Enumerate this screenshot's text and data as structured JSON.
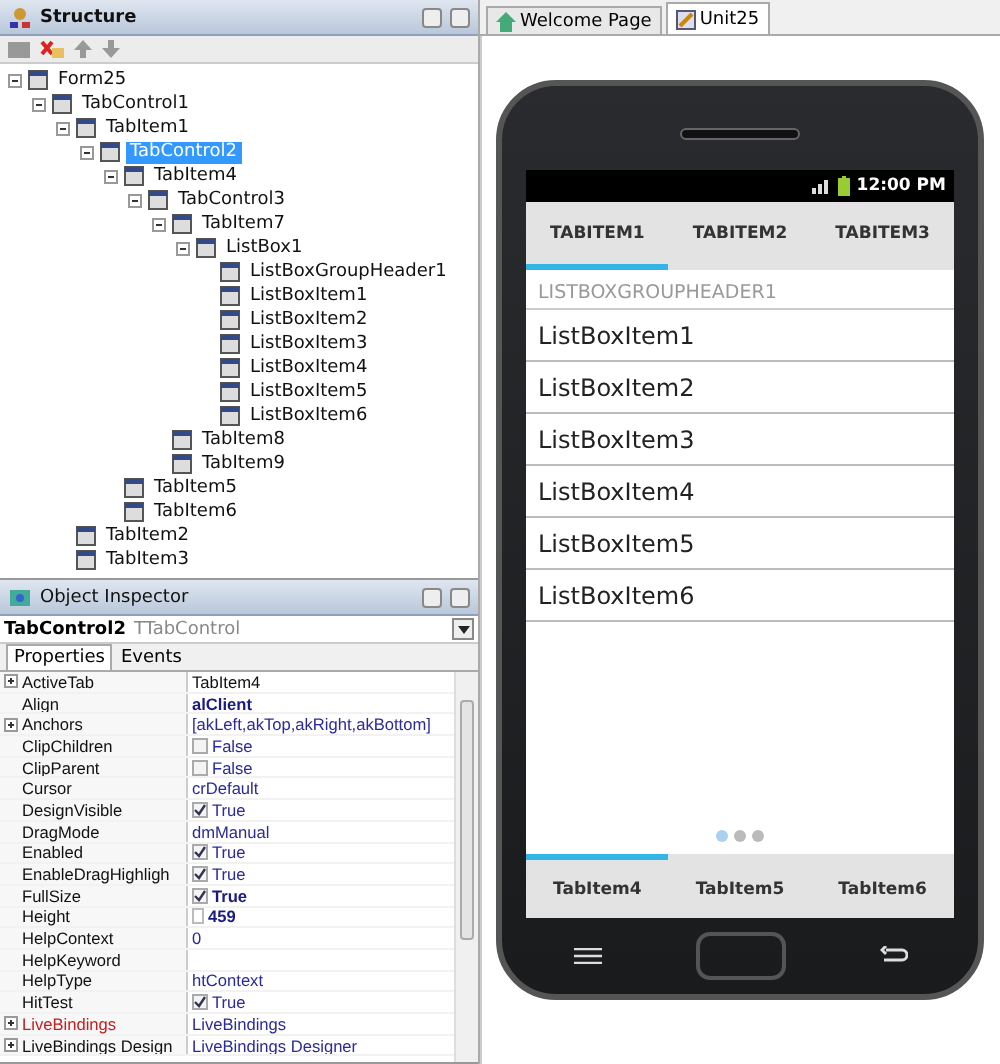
{
  "structure": {
    "title": "Structure",
    "tree": [
      {
        "label": "Form25",
        "selected": false,
        "expanded": true,
        "children": [
          {
            "label": "TabControl1",
            "selected": false,
            "expanded": true,
            "children": [
              {
                "label": "TabItem1",
                "selected": false,
                "expanded": true,
                "children": [
                  {
                    "label": "TabControl2",
                    "selected": true,
                    "expanded": true,
                    "children": [
                      {
                        "label": "TabItem4",
                        "selected": false,
                        "expanded": true,
                        "children": [
                          {
                            "label": "TabControl3",
                            "selected": false,
                            "expanded": true,
                            "children": [
                              {
                                "label": "TabItem7",
                                "selected": false,
                                "expanded": true,
                                "children": [
                                  {
                                    "label": "ListBox1",
                                    "selected": false,
                                    "expanded": true,
                                    "children": [
                                      {
                                        "label": "ListBoxGroupHeader1",
                                        "selected": false
                                      },
                                      {
                                        "label": "ListBoxItem1",
                                        "selected": false
                                      },
                                      {
                                        "label": "ListBoxItem2",
                                        "selected": false
                                      },
                                      {
                                        "label": "ListBoxItem3",
                                        "selected": false
                                      },
                                      {
                                        "label": "ListBoxItem4",
                                        "selected": false
                                      },
                                      {
                                        "label": "ListBoxItem5",
                                        "selected": false
                                      },
                                      {
                                        "label": "ListBoxItem6",
                                        "selected": false
                                      }
                                    ]
                                  }
                                ]
                              },
                              {
                                "label": "TabItem8",
                                "selected": false
                              },
                              {
                                "label": "TabItem9",
                                "selected": false
                              }
                            ]
                          }
                        ]
                      },
                      {
                        "label": "TabItem5",
                        "selected": false
                      },
                      {
                        "label": "TabItem6",
                        "selected": false
                      }
                    ]
                  }
                ]
              },
              {
                "label": "TabItem2",
                "selected": false
              },
              {
                "label": "TabItem3",
                "selected": false
              }
            ]
          }
        ]
      }
    ]
  },
  "inspector": {
    "title": "Object Inspector",
    "object_name": "TabControl2",
    "object_type": "TTabControl",
    "tabs": [
      {
        "label": "Properties",
        "selected": true
      },
      {
        "label": "Events",
        "selected": false
      }
    ],
    "properties": [
      {
        "name": "ActiveTab",
        "value": "TabItem4",
        "kind": "plain",
        "expandable": true
      },
      {
        "name": "Align",
        "value": "alClient",
        "kind": "bold",
        "expandable": false
      },
      {
        "name": "Anchors",
        "value": "[akLeft,akTop,akRight,akBottom]",
        "kind": "value",
        "expandable": true
      },
      {
        "name": "ClipChildren",
        "value": "False",
        "kind": "check",
        "checked": false,
        "expandable": false
      },
      {
        "name": "ClipParent",
        "value": "False",
        "kind": "check",
        "checked": false,
        "expandable": false
      },
      {
        "name": "Cursor",
        "value": "crDefault",
        "kind": "value",
        "expandable": false
      },
      {
        "name": "DesignVisible",
        "value": "True",
        "kind": "check",
        "checked": true,
        "expandable": false
      },
      {
        "name": "DragMode",
        "value": "dmManual",
        "kind": "value",
        "expandable": false
      },
      {
        "name": "Enabled",
        "value": "True",
        "kind": "check",
        "checked": true,
        "expandable": false
      },
      {
        "name": "EnableDragHighligh",
        "value": "True",
        "kind": "check",
        "checked": true,
        "expandable": false
      },
      {
        "name": "FullSize",
        "value": "True",
        "kind": "boldcheck",
        "checked": true,
        "expandable": false
      },
      {
        "name": "Height",
        "value": "459",
        "kind": "spin",
        "expandable": false
      },
      {
        "name": "HelpContext",
        "value": "0",
        "kind": "value",
        "expandable": false
      },
      {
        "name": "HelpKeyword",
        "kind": "value",
        "expandable": false
      },
      {
        "name": "HelpType",
        "value": "htContext",
        "kind": "value",
        "expandable": false
      },
      {
        "name": "HitTest",
        "value": "True",
        "kind": "check",
        "checked": true,
        "expandable": false
      },
      {
        "name": "LiveBindings",
        "value": "LiveBindings",
        "kind": "binding",
        "expandable": true
      },
      {
        "name": "LiveBindings Design",
        "value": "LiveBindings Designer",
        "kind": "value",
        "expandable": true
      }
    ]
  },
  "editor_tabs": [
    {
      "label": "Welcome Page",
      "selected": false
    },
    {
      "label": "Unit25",
      "selected": true
    }
  ],
  "phone": {
    "status_time": "12:00 PM",
    "top_tabs": [
      {
        "label": "TABITEM1",
        "selected": true
      },
      {
        "label": "TABITEM2",
        "selected": false
      },
      {
        "label": "TABITEM3",
        "selected": false
      }
    ],
    "group_header": "LISTBOXGROUPHEADER1",
    "items": [
      "ListBoxItem1",
      "ListBoxItem2",
      "ListBoxItem3",
      "ListBoxItem4",
      "ListBoxItem5",
      "ListBoxItem6"
    ],
    "page_dots": [
      {
        "selected": true
      },
      {
        "selected": false
      },
      {
        "selected": false
      }
    ],
    "bottom_tabs": [
      {
        "label": "TabItem4",
        "selected": true
      },
      {
        "label": "TabItem5",
        "selected": false
      },
      {
        "label": "TabItem6",
        "selected": false
      }
    ]
  }
}
